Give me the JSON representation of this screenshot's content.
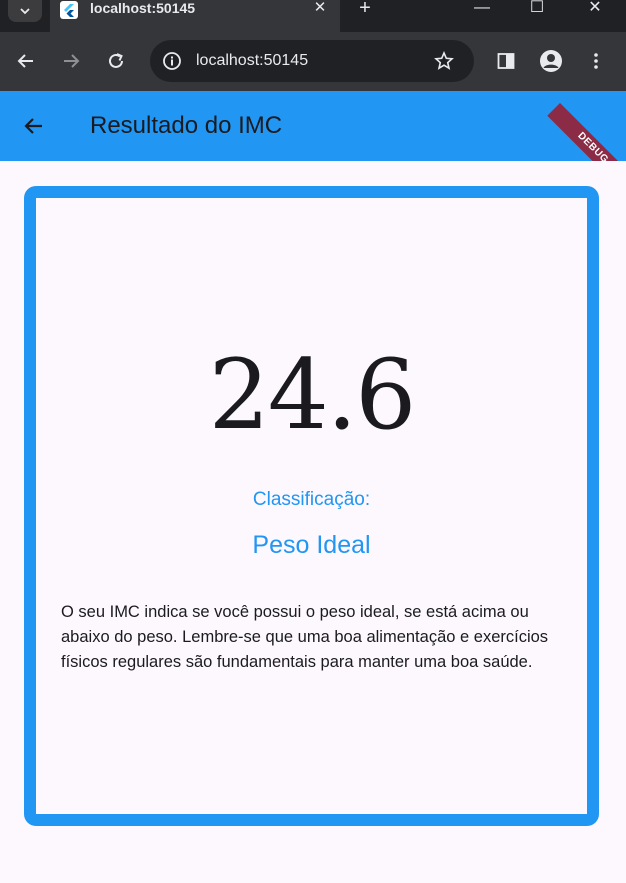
{
  "browser": {
    "tab_title": "localhost:50145",
    "tab_close": "✕",
    "new_tab": "+",
    "url": "localhost:50145",
    "window_minimize": "—",
    "window_maximize": "☐",
    "window_close": "✕"
  },
  "appbar": {
    "title": "Resultado do IMC",
    "debug_banner": "DEBUG",
    "background_color": "#2196f3"
  },
  "result": {
    "imc_value": "24.6",
    "classification_label": "Classificação:",
    "classification_value": "Peso Ideal",
    "description": "O seu IMC indica se você possui o peso ideal, se está acima ou abaixo do peso. Lembre-se que uma boa alimentação e exercícios físicos regulares são fundamentais para manter uma boa saúde."
  },
  "colors": {
    "accent": "#2196f3",
    "surface": "#fdf8fd",
    "text": "#1b1b1f",
    "debug_ribbon": "#8b2b45"
  },
  "icons": {
    "tab_search": "chevron-down-icon",
    "favicon": "flutter-icon",
    "back": "arrow-left-icon",
    "forward": "arrow-right-icon",
    "reload": "reload-icon",
    "site_info": "info-icon",
    "bookmark": "star-icon",
    "side_panel": "side-panel-icon",
    "profile": "profile-icon",
    "menu": "more-vertical-icon",
    "app_back": "arrow-left-icon"
  }
}
